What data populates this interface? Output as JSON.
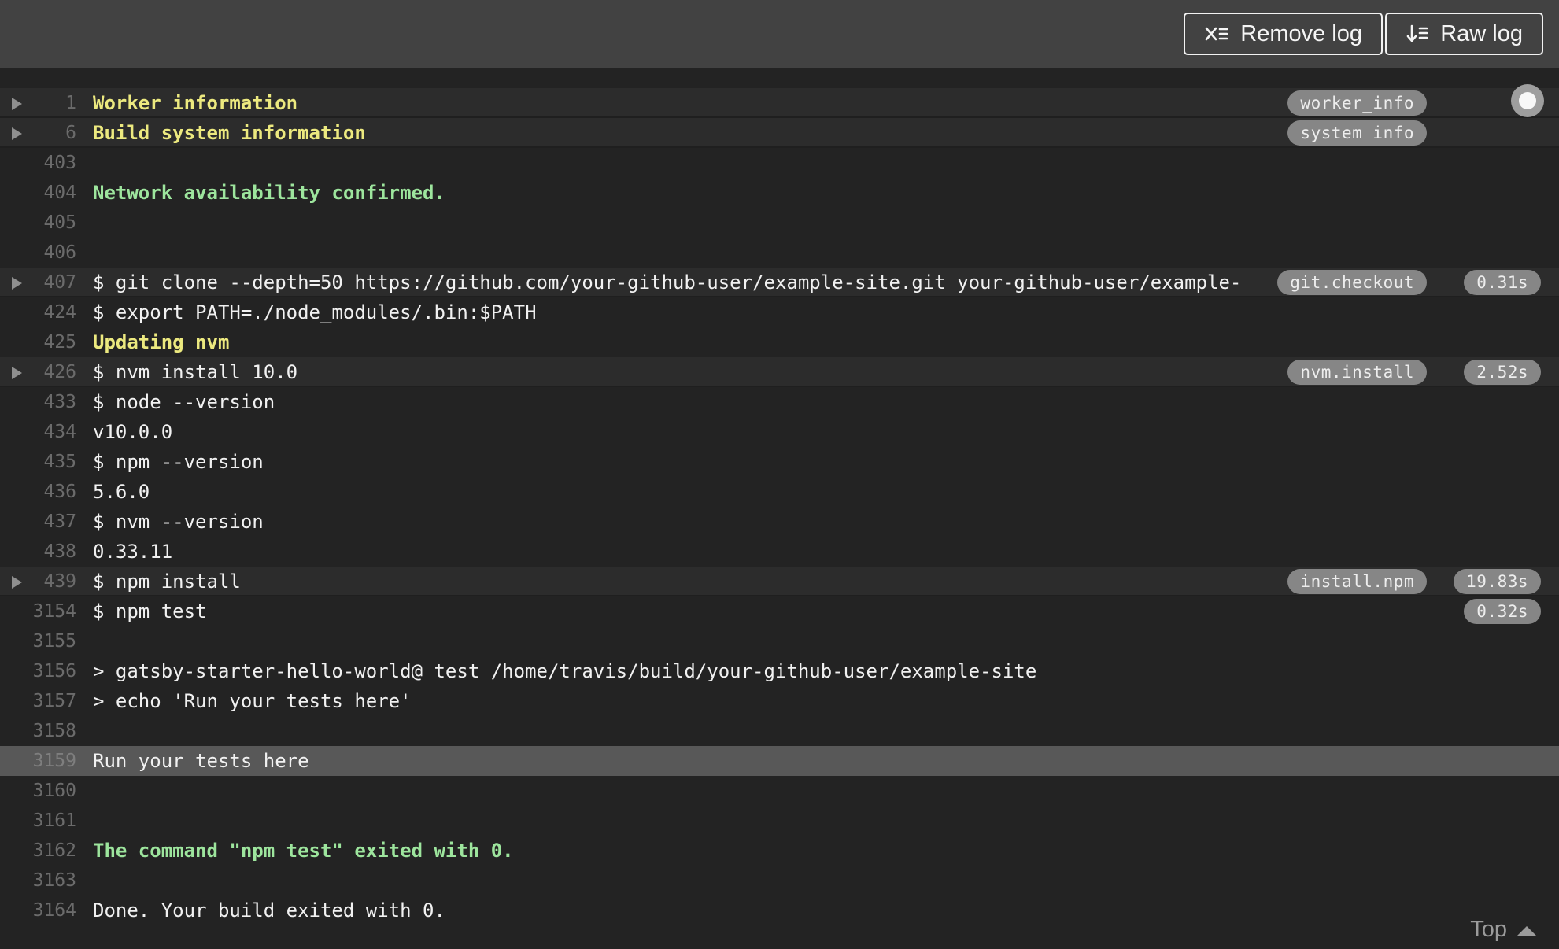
{
  "header": {
    "buttons": [
      {
        "label": "Remove log",
        "icon": "remove-log-icon"
      },
      {
        "label": "Raw log",
        "icon": "raw-log-icon"
      }
    ]
  },
  "log": {
    "lines": [
      {
        "num": "1",
        "text": "Worker information",
        "color": "yellow",
        "fold": true,
        "tag": "worker_info",
        "duration": null,
        "row": "fold"
      },
      {
        "num": "6",
        "text": "Build system information",
        "color": "yellow",
        "fold": true,
        "tag": "system_info",
        "duration": null,
        "row": "fold"
      },
      {
        "num": "403",
        "text": "",
        "color": "plain",
        "fold": false,
        "tag": null,
        "duration": null,
        "row": "normal"
      },
      {
        "num": "404",
        "text": "Network availability confirmed.",
        "color": "green",
        "fold": false,
        "tag": null,
        "duration": null,
        "row": "normal"
      },
      {
        "num": "405",
        "text": "",
        "color": "plain",
        "fold": false,
        "tag": null,
        "duration": null,
        "row": "normal"
      },
      {
        "num": "406",
        "text": "",
        "color": "plain",
        "fold": false,
        "tag": null,
        "duration": null,
        "row": "normal"
      },
      {
        "num": "407",
        "text": "$ git clone --depth=50 https://github.com/your-github-user/example-site.git your-github-user/example-",
        "color": "plain",
        "fold": true,
        "tag": "git.checkout",
        "duration": "0.31s",
        "row": "fold"
      },
      {
        "num": "424",
        "text": "$ export PATH=./node_modules/.bin:$PATH",
        "color": "plain",
        "fold": false,
        "tag": null,
        "duration": null,
        "row": "normal"
      },
      {
        "num": "425",
        "text": "Updating nvm",
        "color": "yellow",
        "fold": false,
        "tag": null,
        "duration": null,
        "row": "normal"
      },
      {
        "num": "426",
        "text": "$ nvm install 10.0",
        "color": "plain",
        "fold": true,
        "tag": "nvm.install",
        "duration": "2.52s",
        "row": "fold"
      },
      {
        "num": "433",
        "text": "$ node --version",
        "color": "plain",
        "fold": false,
        "tag": null,
        "duration": null,
        "row": "normal"
      },
      {
        "num": "434",
        "text": "v10.0.0",
        "color": "plain",
        "fold": false,
        "tag": null,
        "duration": null,
        "row": "normal"
      },
      {
        "num": "435",
        "text": "$ npm --version",
        "color": "plain",
        "fold": false,
        "tag": null,
        "duration": null,
        "row": "normal"
      },
      {
        "num": "436",
        "text": "5.6.0",
        "color": "plain",
        "fold": false,
        "tag": null,
        "duration": null,
        "row": "normal"
      },
      {
        "num": "437",
        "text": "$ nvm --version",
        "color": "plain",
        "fold": false,
        "tag": null,
        "duration": null,
        "row": "normal"
      },
      {
        "num": "438",
        "text": "0.33.11",
        "color": "plain",
        "fold": false,
        "tag": null,
        "duration": null,
        "row": "normal"
      },
      {
        "num": "439",
        "text": "$ npm install",
        "color": "plain",
        "fold": true,
        "tag": "install.npm",
        "duration": "19.83s",
        "row": "fold"
      },
      {
        "num": "3154",
        "text": "$ npm test",
        "color": "plain",
        "fold": false,
        "tag": null,
        "duration": "0.32s",
        "row": "normal"
      },
      {
        "num": "3155",
        "text": "",
        "color": "plain",
        "fold": false,
        "tag": null,
        "duration": null,
        "row": "normal"
      },
      {
        "num": "3156",
        "text": "> gatsby-starter-hello-world@ test /home/travis/build/your-github-user/example-site",
        "color": "plain",
        "fold": false,
        "tag": null,
        "duration": null,
        "row": "normal"
      },
      {
        "num": "3157",
        "text": "> echo 'Run your tests here'",
        "color": "plain",
        "fold": false,
        "tag": null,
        "duration": null,
        "row": "normal"
      },
      {
        "num": "3158",
        "text": "",
        "color": "plain",
        "fold": false,
        "tag": null,
        "duration": null,
        "row": "normal"
      },
      {
        "num": "3159",
        "text": "Run your tests here",
        "color": "plain",
        "fold": false,
        "tag": null,
        "duration": null,
        "row": "selected"
      },
      {
        "num": "3160",
        "text": "",
        "color": "plain",
        "fold": false,
        "tag": null,
        "duration": null,
        "row": "normal"
      },
      {
        "num": "3161",
        "text": "",
        "color": "plain",
        "fold": false,
        "tag": null,
        "duration": null,
        "row": "normal"
      },
      {
        "num": "3162",
        "text": "The command \"npm test\" exited with 0.",
        "color": "green",
        "fold": false,
        "tag": null,
        "duration": null,
        "row": "normal"
      },
      {
        "num": "3163",
        "text": "",
        "color": "plain",
        "fold": false,
        "tag": null,
        "duration": null,
        "row": "normal"
      },
      {
        "num": "3164",
        "text": "Done. Your build exited with 0.",
        "color": "plain",
        "fold": false,
        "tag": null,
        "duration": null,
        "row": "normal"
      }
    ]
  },
  "footer": {
    "top_label": "Top"
  },
  "colors": {
    "toolbar_background": "#424242",
    "log_background": "#232323",
    "fold_row_background": "#2c2c2c",
    "selected_row_background": "#585858",
    "fold_yellow": "#ece97f",
    "success_green": "#9de59d",
    "text": "#f1f1f1",
    "line_number": "#6b6b6b",
    "pill_background": "#868686"
  }
}
